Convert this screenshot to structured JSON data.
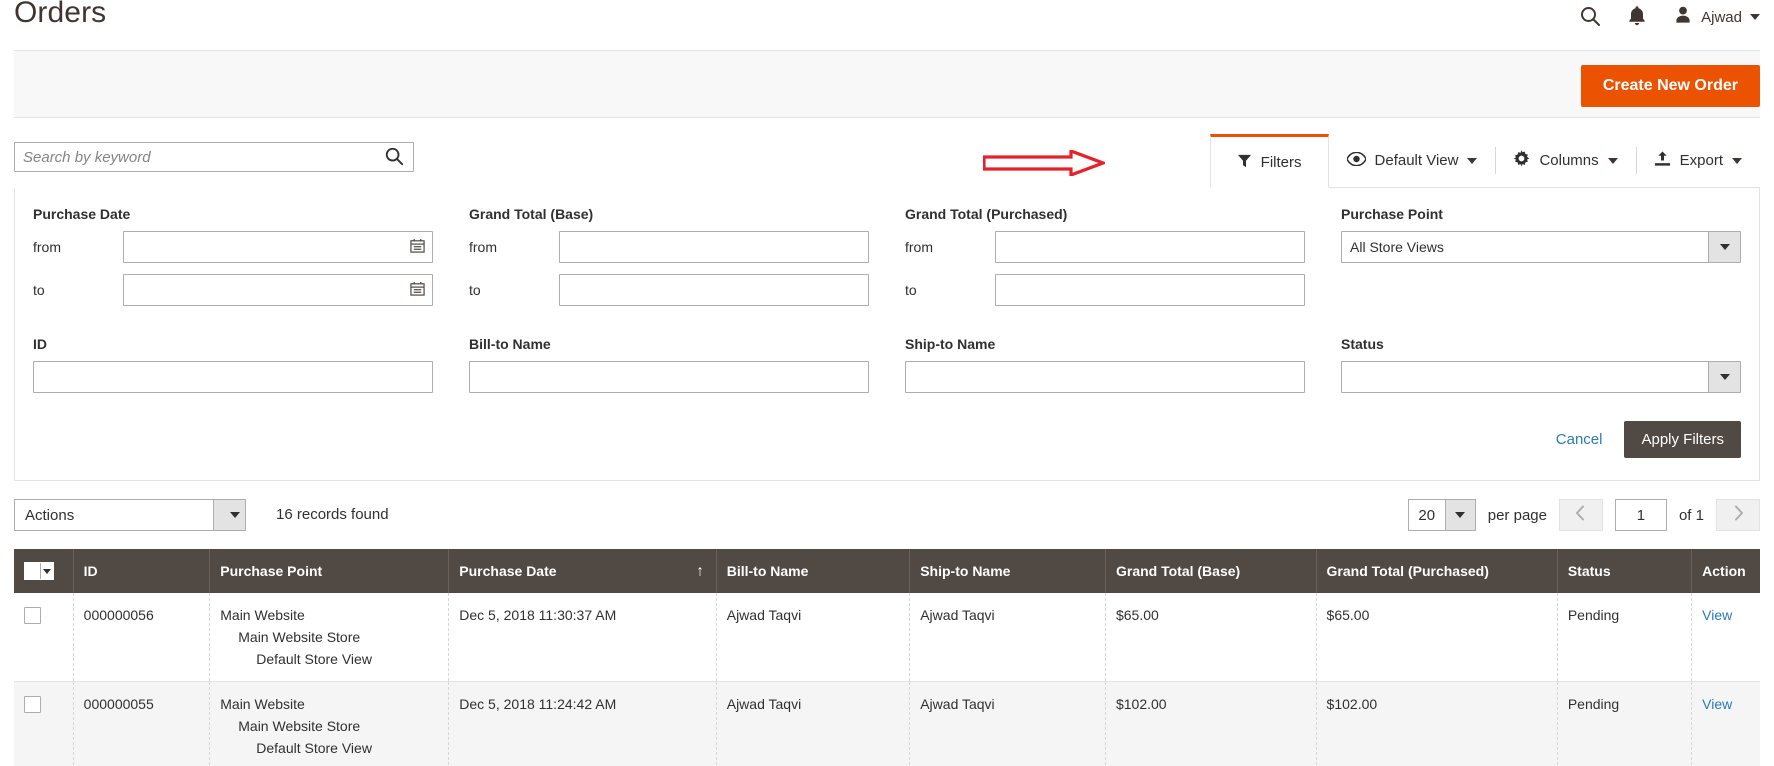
{
  "header": {
    "title": "Orders",
    "search_icon": "search-icon",
    "notifications_icon": "bell-icon",
    "avatar_icon": "user-avatar-icon",
    "user_name": "Ajwad"
  },
  "action_bar": {
    "create_order_label": "Create New Order"
  },
  "search": {
    "placeholder": "Search by keyword",
    "value": "",
    "icon": "search-icon"
  },
  "grid_toolbar": {
    "filters_label": "Filters",
    "filters_icon": "funnel-icon",
    "view_label": "Default View",
    "view_icon": "eye-icon",
    "columns_label": "Columns",
    "columns_icon": "gear-icon",
    "export_label": "Export",
    "export_icon": "upload-icon"
  },
  "annotation": {
    "type": "arrow",
    "color": "#e8202a",
    "points_to": "filters-tab"
  },
  "filters": {
    "purchase_date": {
      "label": "Purchase Date",
      "from_label": "from",
      "to_label": "to",
      "from_value": "",
      "to_value": "",
      "calendar_icon": "calendar-icon"
    },
    "grand_total_base": {
      "label": "Grand Total (Base)",
      "from_label": "from",
      "to_label": "to",
      "from_value": "",
      "to_value": ""
    },
    "grand_total_purchased": {
      "label": "Grand Total (Purchased)",
      "from_label": "from",
      "to_label": "to",
      "from_value": "",
      "to_value": ""
    },
    "purchase_point": {
      "label": "Purchase Point",
      "value": "All Store Views"
    },
    "id": {
      "label": "ID",
      "value": ""
    },
    "bill_to_name": {
      "label": "Bill-to Name",
      "value": ""
    },
    "ship_to_name": {
      "label": "Ship-to Name",
      "value": ""
    },
    "status": {
      "label": "Status",
      "value": ""
    },
    "cancel_label": "Cancel",
    "apply_label": "Apply Filters"
  },
  "grid_controls": {
    "actions_label": "Actions",
    "records_found": "16 records found",
    "per_page_value": "20",
    "per_page_label": "per page",
    "current_page": "1",
    "of_pages": "of 1",
    "prev_icon": "chevron-left-icon",
    "next_icon": "chevron-right-icon"
  },
  "table": {
    "columns": [
      "ID",
      "Purchase Point",
      "Purchase Date",
      "Bill-to Name",
      "Ship-to Name",
      "Grand Total (Base)",
      "Grand Total (Purchased)",
      "Status",
      "Action"
    ],
    "sort_column": "Purchase Date",
    "sort_direction": "asc",
    "sort_glyph": "↑",
    "rows": [
      {
        "id": "000000056",
        "purchase_point_1": "Main Website",
        "purchase_point_2": "Main Website Store",
        "purchase_point_3": "Default Store View",
        "purchase_date": "Dec 5, 2018 11:30:37 AM",
        "bill_to_name": "Ajwad Taqvi",
        "ship_to_name": "Ajwad Taqvi",
        "grand_total_base": "$65.00",
        "grand_total_purchased": "$65.00",
        "status": "Pending",
        "action": "View"
      },
      {
        "id": "000000055",
        "purchase_point_1": "Main Website",
        "purchase_point_2": "Main Website Store",
        "purchase_point_3": "Default Store View",
        "purchase_date": "Dec 5, 2018 11:24:42 AM",
        "bill_to_name": "Ajwad Taqvi",
        "ship_to_name": "Ajwad Taqvi",
        "grand_total_base": "$102.00",
        "grand_total_purchased": "$102.00",
        "status": "Pending",
        "action": "View"
      }
    ]
  }
}
